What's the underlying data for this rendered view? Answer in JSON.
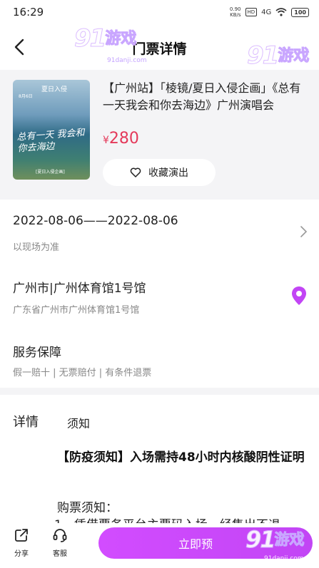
{
  "status_bar": {
    "time": "16:29",
    "net_speed_value": "0.90",
    "net_speed_unit": "KB/s",
    "hd": "HD",
    "signal": "4G",
    "battery": "100"
  },
  "header": {
    "title": "门票详情"
  },
  "watermark": {
    "logo": "91",
    "text": "游戏",
    "url": "91danji.com"
  },
  "event": {
    "title": "【广州站】「棱镜/夏日入侵企画」《总有一天我会和你去海边》广州演唱会",
    "price_symbol": "¥",
    "price": "280",
    "favorite_label": "收藏演出",
    "poster": {
      "top_text": "夏日入侵",
      "date_text": "8月6日",
      "title_text": "总有一天 我会和你去海边",
      "footer_text": "[夏日入侵企画]"
    }
  },
  "schedule": {
    "date_range": "2022-08-06——2022-08-06",
    "note": "以现场为准"
  },
  "venue": {
    "name": "广州市|广州体育馆1号馆",
    "address": "广东省广州市广州体育馆1号馆"
  },
  "service": {
    "title": "服务保障",
    "items": "假一赔十 | 无票赔付 | 有条件退票"
  },
  "tabs": {
    "detail": "详情",
    "notice": "须知"
  },
  "notice": {
    "headline": "【防疫须知】入场需持48小时内核酸阴性证明",
    "buy_label": "购票须知：",
    "clipped_line": "1、凭借票务平台主票码入场一经售出不退..."
  },
  "bottom_bar": {
    "share_label": "分享",
    "service_label": "客服",
    "buy_label": "立即预"
  },
  "colors": {
    "accent": "#c245f5",
    "price": "#e4395a",
    "location_pin": "#c245f5"
  }
}
